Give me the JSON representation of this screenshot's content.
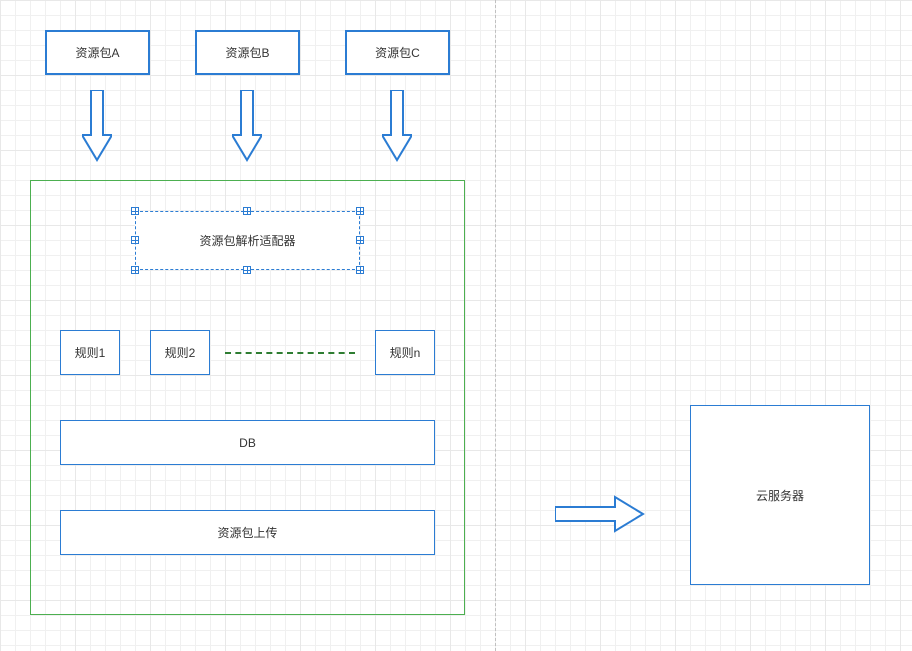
{
  "packages": {
    "a": "资源包A",
    "b": "资源包B",
    "c": "资源包C"
  },
  "adapter": "资源包解析适配器",
  "rules": {
    "r1": "规则1",
    "r2": "规则2",
    "rn": "规则n"
  },
  "db": "DB",
  "upload": "资源包上传",
  "cloud": "云服务器"
}
